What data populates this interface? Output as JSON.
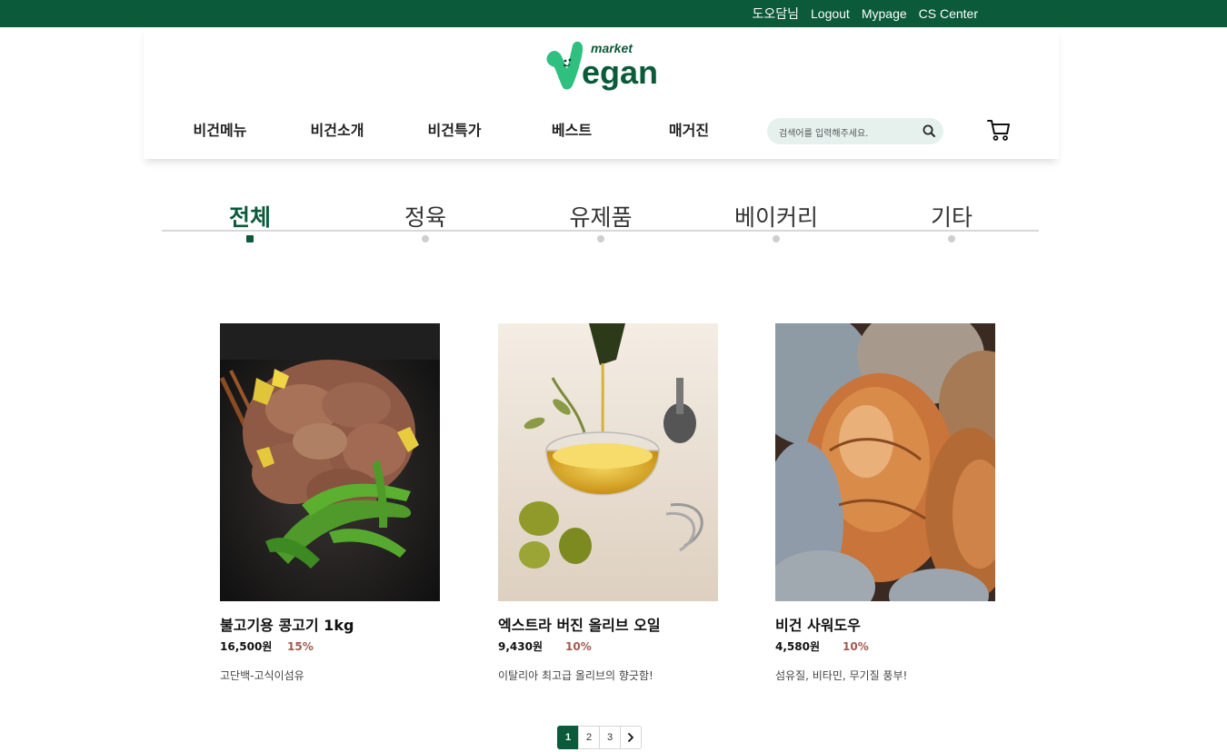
{
  "topbar": {
    "user": "도오담님",
    "logout": "Logout",
    "mypage": "Mypage",
    "cs_center": "CS Center",
    "bg_color": "#0b5a3a"
  },
  "logo": {
    "small_text": "market",
    "main_text": "egan"
  },
  "nav": {
    "items": [
      {
        "label": "비건메뉴"
      },
      {
        "label": "비건소개"
      },
      {
        "label": "비건특가"
      },
      {
        "label": "베스트"
      },
      {
        "label": "매거진"
      }
    ],
    "search_placeholder": "검색어를 입력해주세요.",
    "search_icon": "search-icon",
    "cart_icon": "cart-icon"
  },
  "categories": {
    "items": [
      {
        "label": "전체",
        "active": true
      },
      {
        "label": "정육",
        "active": false
      },
      {
        "label": "유제품",
        "active": false
      },
      {
        "label": "베이커리",
        "active": false
      },
      {
        "label": "기타",
        "active": false
      }
    ],
    "accent_color": "#0b5a3a"
  },
  "products": [
    {
      "name": "불고기용 콩고기 1kg",
      "price": "16,500원",
      "discount": "15%",
      "desc": "고단백-고식이섬유"
    },
    {
      "name": "엑스트라 버진 올리브 오일",
      "price": "9,430원",
      "discount": "10%",
      "desc": "이탈리아 최고급 올리브의 향긋함!"
    },
    {
      "name": "비건 사워도우",
      "price": "4,580원",
      "discount": "10%",
      "desc": "섬유질, 비타민, 무기질 풍부!"
    }
  ],
  "pagination": {
    "pages": [
      "1",
      "2",
      "3"
    ],
    "current": "1",
    "next_icon": "chevron-right-icon"
  }
}
